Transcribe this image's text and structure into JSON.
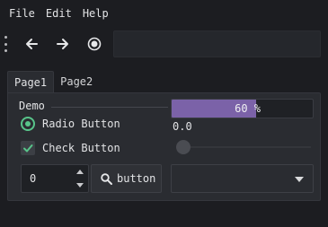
{
  "menubar": {
    "items": [
      "File",
      "Edit",
      "Help"
    ]
  },
  "toolbar": {
    "buttons": [
      {
        "icon": "arrow-left-icon"
      },
      {
        "icon": "arrow-right-icon"
      },
      {
        "icon": "radio-circle-icon"
      }
    ],
    "address_value": ""
  },
  "tabs": [
    {
      "label": "Page1",
      "active": true
    },
    {
      "label": "Page2",
      "active": false
    }
  ],
  "page1": {
    "group_title": "Demo",
    "radio_label": "Radio Button",
    "radio_checked": true,
    "check_label": "Check Button",
    "check_checked": true,
    "spinbox_value": "0",
    "tool_button_label": "button",
    "tool_button_icon": "search-icon",
    "progress_text": "60 %",
    "progress_value": 60,
    "slider_value_text": "0.0",
    "slider_value": 0,
    "combo_value": ""
  },
  "colors": {
    "background": "#1c1d21",
    "panel": "#2a2c31",
    "accent_green": "#58c48a",
    "progress_purple": "#7b62a8",
    "text": "#e2e3e5"
  }
}
